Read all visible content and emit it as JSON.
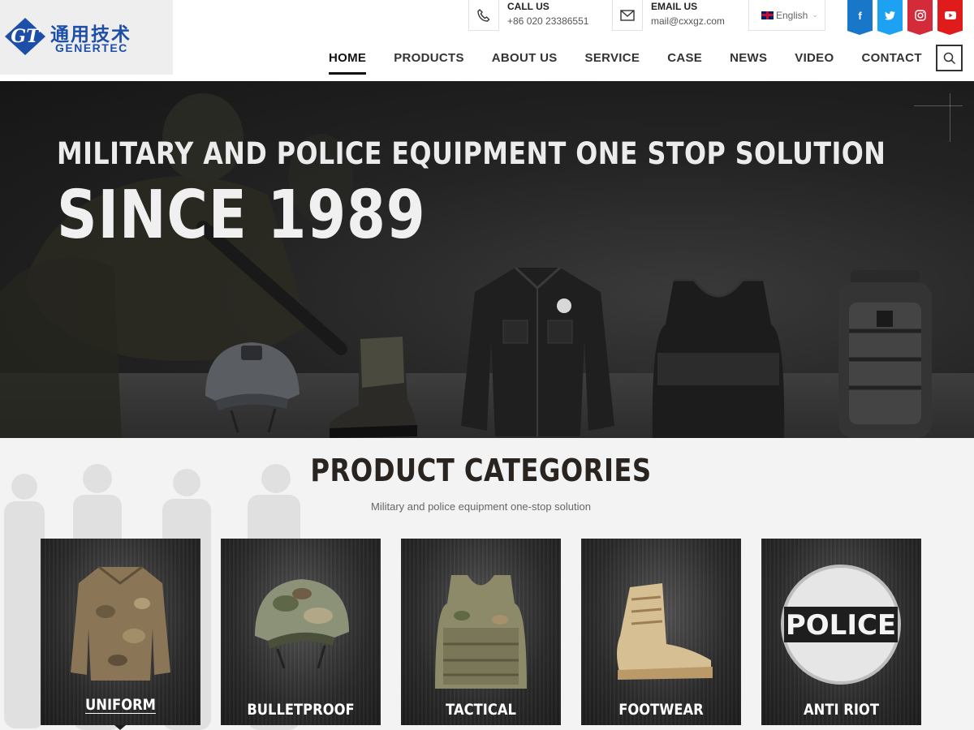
{
  "brand": {
    "name_cn": "通用技术",
    "name_en": "GENERTEC"
  },
  "header": {
    "call": {
      "title": "CALL US",
      "value": "+86 020 23386551"
    },
    "email": {
      "title": "EMAIL US",
      "value": "mail@cxxgz.com"
    },
    "language": "English",
    "social": [
      {
        "name": "facebook-icon",
        "glyph": "f",
        "color": "#1877c9"
      },
      {
        "name": "twitter-icon",
        "glyph": "t",
        "color": "#1da1f2"
      },
      {
        "name": "instagram-icon",
        "glyph": "ig",
        "color": "#d42b3a"
      },
      {
        "name": "youtube-icon",
        "glyph": "yt",
        "color": "#e01b1b"
      }
    ]
  },
  "nav": {
    "items": [
      "HOME",
      "PRODUCTS",
      "ABOUT US",
      "SERVICE",
      "CASE",
      "NEWS",
      "VIDEO",
      "CONTACT"
    ],
    "active": "HOME"
  },
  "hero": {
    "title": "MILITARY AND POLICE EQUIPMENT ONE STOP SOLUTION",
    "subtitle": "SINCE 1989"
  },
  "categories": {
    "title": "PRODUCT CATEGORIES",
    "subtitle": "Military and police equipment one-stop solution",
    "items": [
      {
        "label": "UNIFORM",
        "active": true
      },
      {
        "label": "BULLETPROOF"
      },
      {
        "label": "TACTICAL"
      },
      {
        "label": "FOOTWEAR"
      },
      {
        "label": "ANTI RIOT",
        "shield_text": "POLICE"
      }
    ]
  }
}
